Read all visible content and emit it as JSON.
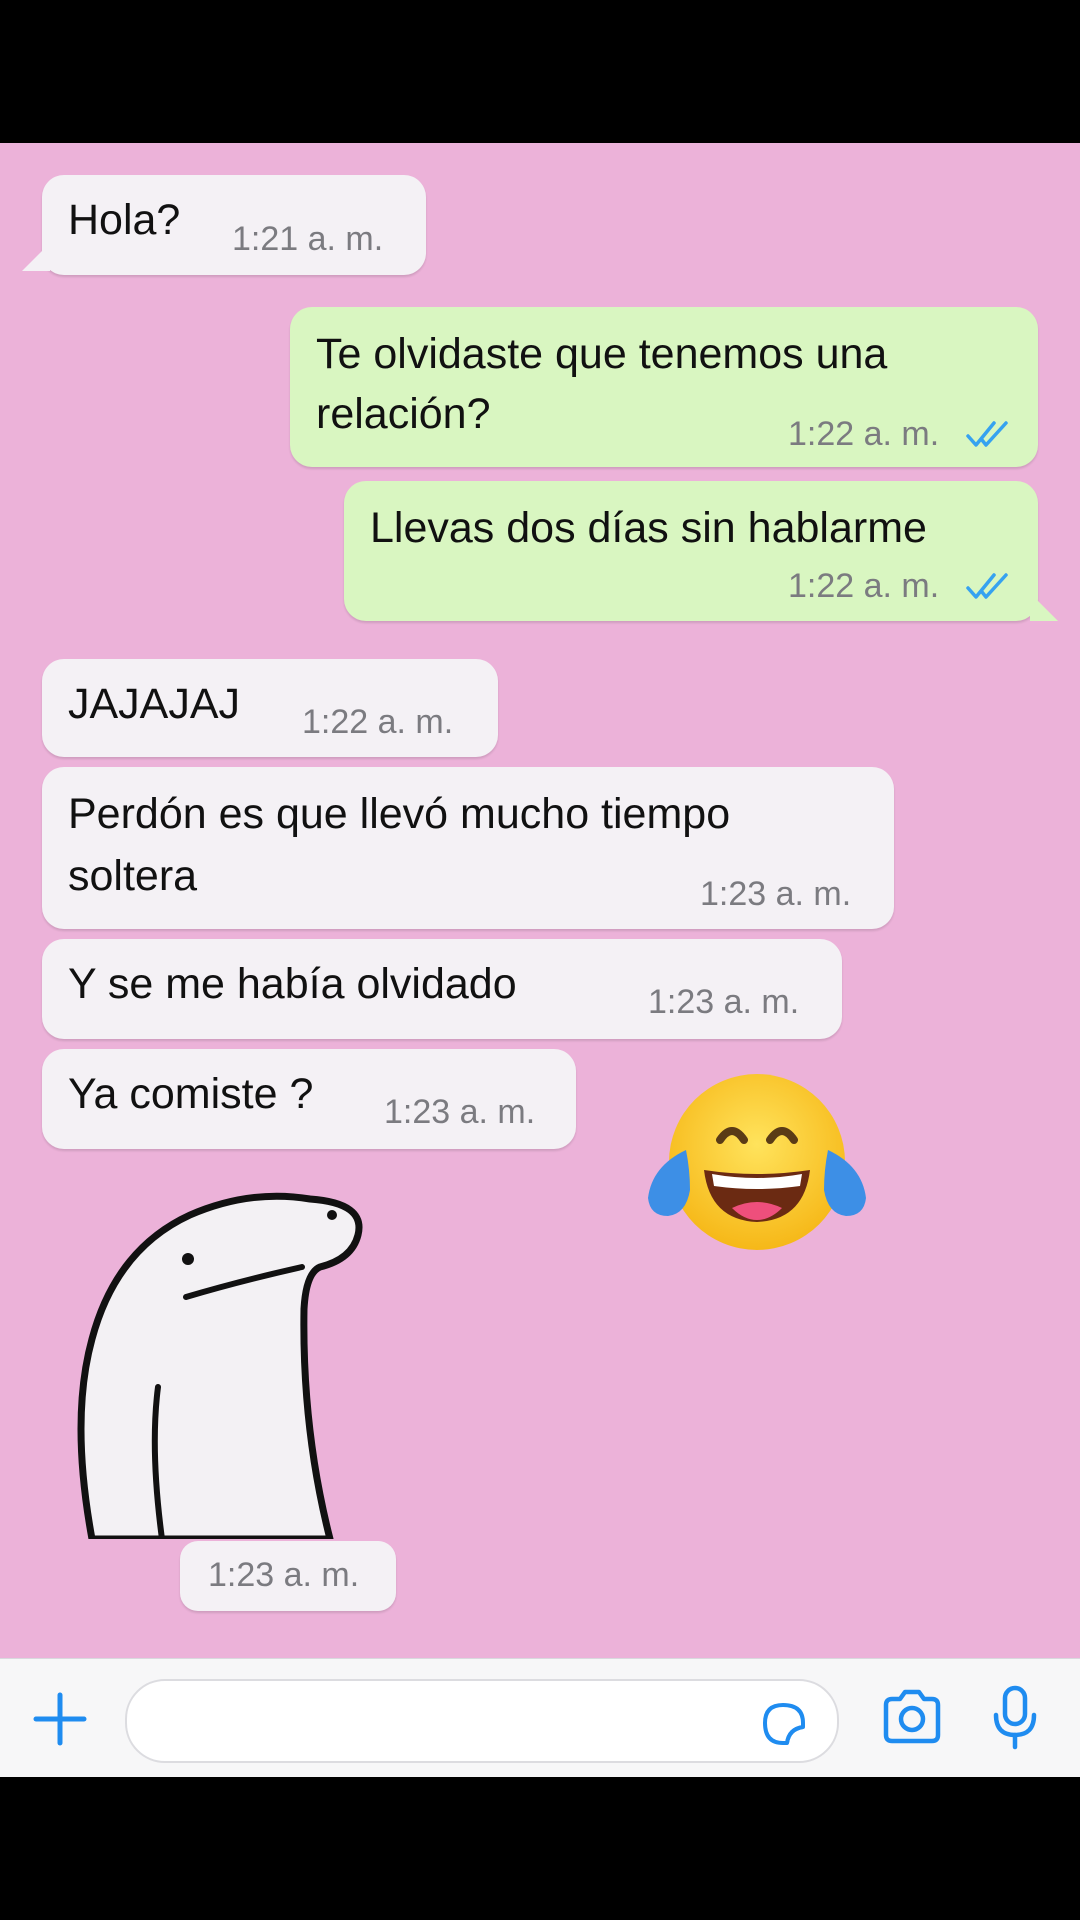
{
  "colors": {
    "chat_bg": "#ecb2d9",
    "incoming_bubble": "#f4f1f5",
    "outgoing_bubble": "#d9f6c1",
    "accent_blue": "#1f8cf0",
    "read_check": "#36a2f0",
    "input_bar": "#f7f7f8"
  },
  "messages": [
    {
      "text": "Hola?",
      "time": "1:21 a. m."
    },
    {
      "line1": "Te olvidaste que tenemos una",
      "line2": "relación?",
      "time": "1:22 a. m.",
      "status": "read-double-check-icon"
    },
    {
      "text": "Llevas dos días sin hablarme",
      "time": "1:22 a. m.",
      "status": "read-double-check-icon"
    },
    {
      "text": "JAJAJAJ",
      "time": "1:22 a. m."
    },
    {
      "line1": "Perdón es que llevó mucho tiempo",
      "line2": "soltera",
      "time": "1:23 a. m."
    },
    {
      "text": "Y se me había olvidado",
      "time": "1:23 a. m."
    },
    {
      "text": "Ya comiste ?",
      "time": "1:23 a. m."
    },
    {
      "sticker": "flork-sticker",
      "time": "1:23 a. m."
    }
  ],
  "emoji_overlay": "tears-of-joy-emoji",
  "input_bar": {
    "add_icon": "plus-icon",
    "sticker_icon": "sticker-icon",
    "camera_icon": "camera-icon",
    "mic_icon": "microphone-icon",
    "message_value": ""
  }
}
